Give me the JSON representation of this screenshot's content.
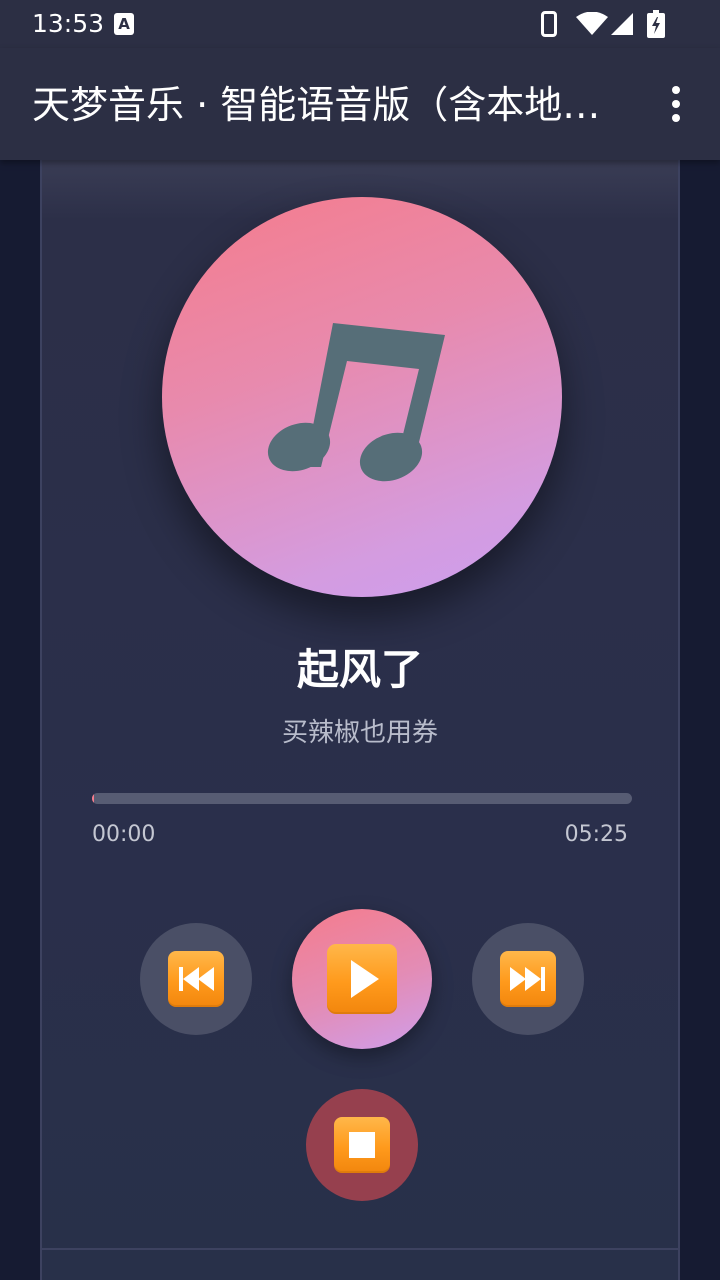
{
  "status_bar": {
    "time": "13:53",
    "notification_badge": "A"
  },
  "app_bar": {
    "title": "天梦音乐 · 智能语音版（含本地音乐）"
  },
  "player": {
    "song_title": "起风了",
    "artist": "买辣椒也用券",
    "current_time": "00:00",
    "total_time": "05:25",
    "progress_fraction": 0.0
  },
  "colors": {
    "accent_pink": "#f57c8c",
    "accent_lilac": "#cc9ef0",
    "stop_red": "#96404e",
    "button_orange": "#ff9a1c"
  },
  "icons": {
    "prev": "rewind-icon",
    "play": "play-icon",
    "next": "fast-forward-icon",
    "stop": "stop-icon",
    "album": "music-note-icon"
  }
}
